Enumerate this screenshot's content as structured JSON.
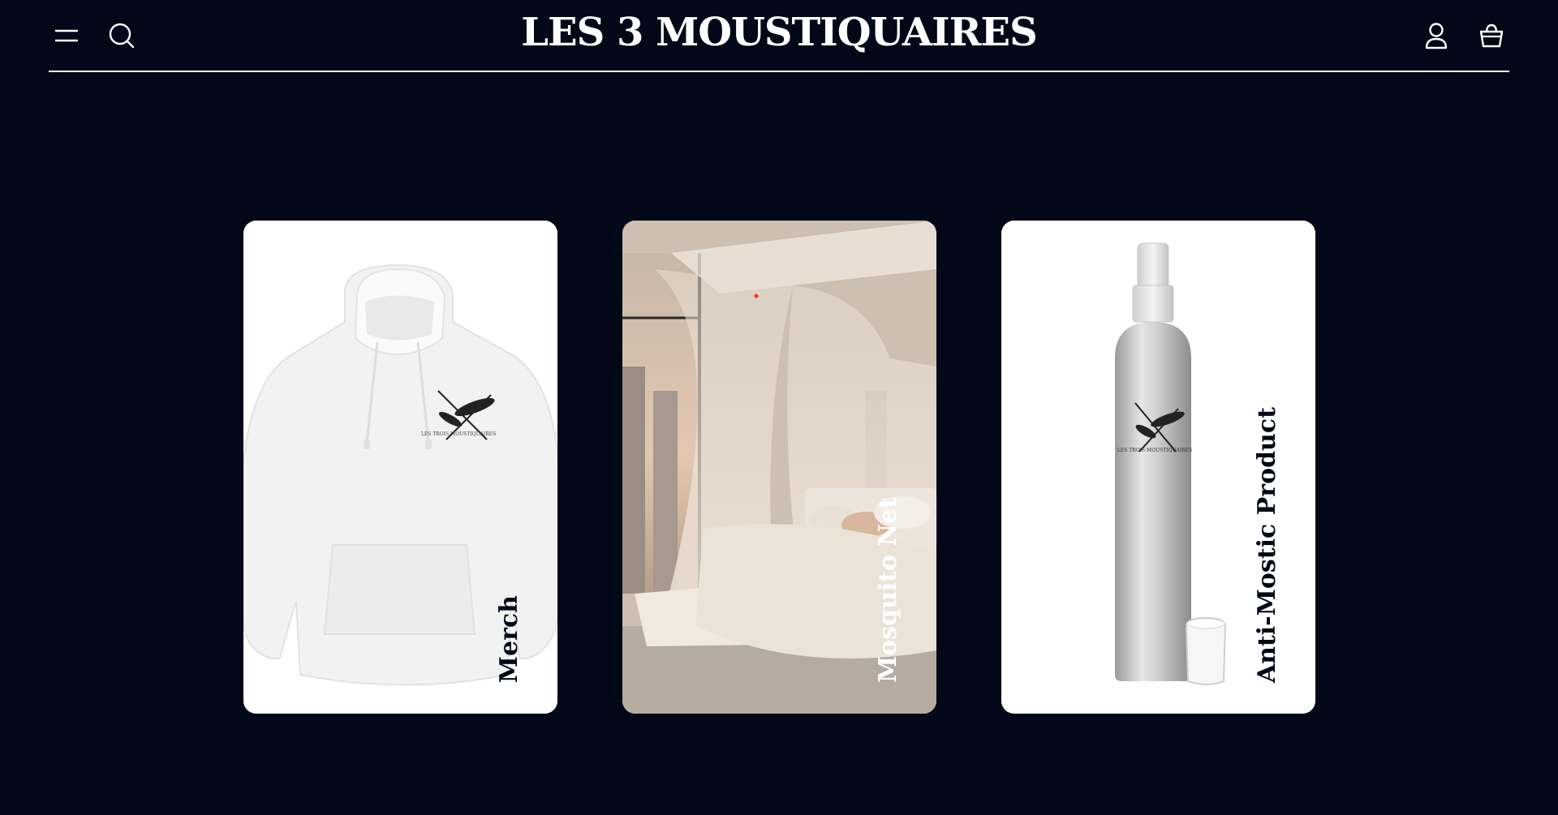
{
  "header": {
    "logo": "LES 3 MOUSTIQUAIRES",
    "icons": [
      "menu-icon",
      "search-icon",
      "account-icon",
      "cart-icon"
    ]
  },
  "categories": [
    {
      "label": "Merch",
      "image": "white hoodie with mosquito logo"
    },
    {
      "label": "Mosquito Net",
      "image": "canopy bed with mosquito net by city window"
    },
    {
      "label": "Anti-Mostic Product",
      "image": "aluminium spray bottle with mosquito logo"
    }
  ],
  "colors": {
    "background": "#020817",
    "text": "#ffffff",
    "card": "#ffffff",
    "card_text": "#020817"
  }
}
